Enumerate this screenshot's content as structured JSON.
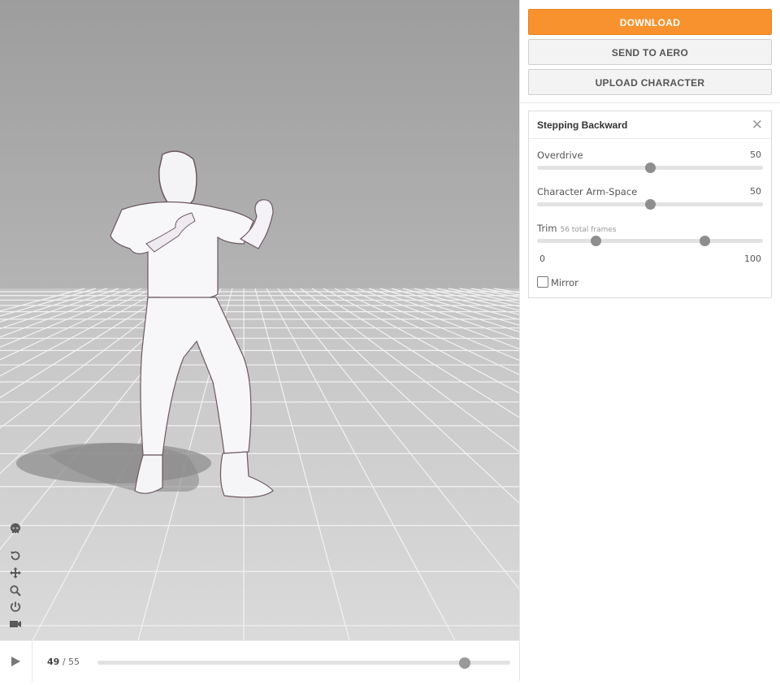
{
  "viewport": {
    "tools": [
      {
        "icon": "skull-icon"
      },
      {
        "icon": "rotate-icon"
      },
      {
        "icon": "pan-icon"
      },
      {
        "icon": "zoom-icon"
      },
      {
        "icon": "power-icon"
      },
      {
        "icon": "camera-icon"
      }
    ]
  },
  "playbar": {
    "current_frame": "49",
    "separator": "/",
    "total_frames": "55",
    "progress": 0.89
  },
  "sidebar": {
    "download_label": "DOWNLOAD",
    "send_label": "SEND TO AERO",
    "upload_label": "UPLOAD CHARACTER"
  },
  "panel": {
    "title": "Stepping Backward",
    "close_icon": "close-icon",
    "overdrive": {
      "label": "Overdrive",
      "value": "50",
      "fraction": 0.5
    },
    "arm_space": {
      "label": "Character Arm-Space",
      "value": "50",
      "fraction": 0.5
    },
    "trim": {
      "label": "Trim",
      "note": "56 total frames",
      "min_label": "0",
      "max_label": "100",
      "start_fraction": 0.26,
      "end_fraction": 0.74
    },
    "mirror": {
      "label": "Mirror",
      "checked": false
    }
  },
  "colors": {
    "accent": "#f7922e",
    "viewport_bg": "#9e9e9e",
    "floor": "#d2d2d2"
  }
}
